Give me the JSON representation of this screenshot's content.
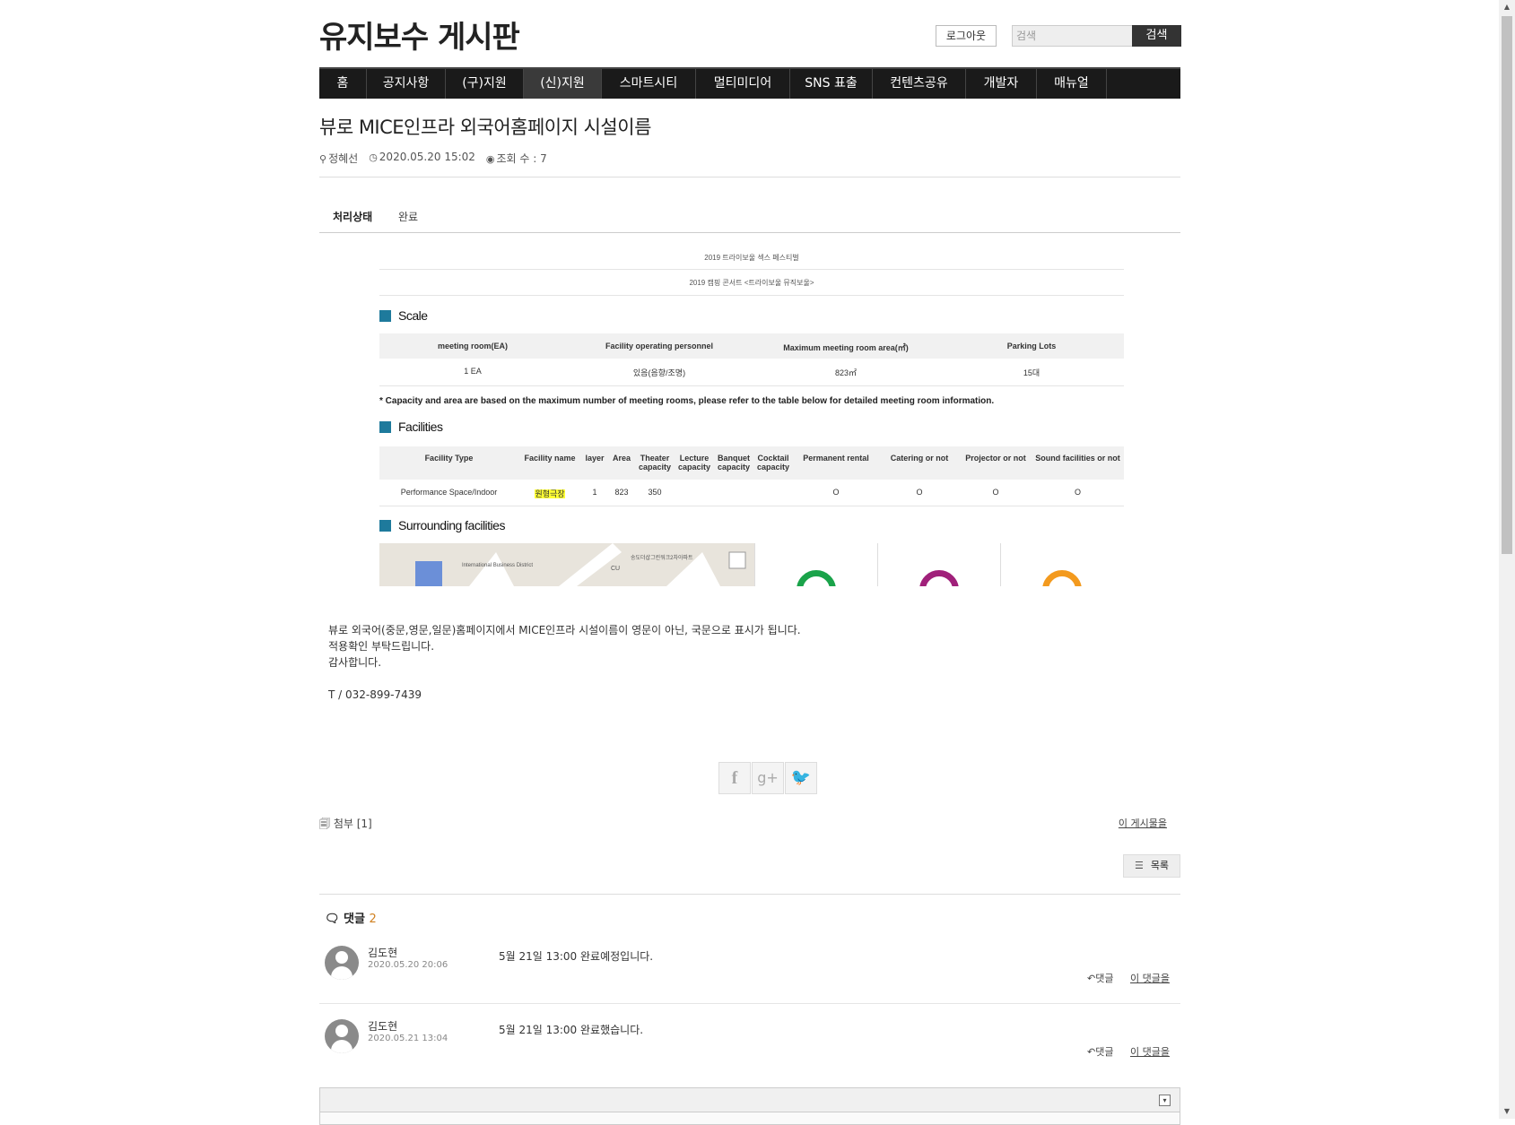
{
  "site": {
    "title": "유지보수 게시판"
  },
  "header": {
    "logout_label": "로그아웃",
    "search_placeholder": "검색",
    "search_button": "검색"
  },
  "nav": {
    "items": [
      "홈",
      "공지사항",
      "(구)지원",
      "(신)지원",
      "스마트시티",
      "멀티미디어",
      "SNS 표출",
      "컨텐츠공유",
      "개발자",
      "매뉴얼"
    ],
    "active": "(신)지원"
  },
  "post": {
    "title": "뷰로 MICE인프라 외국어홈페이지 시설이름",
    "author": "정혜선",
    "datetime": "2020.05.20 15:02",
    "views": "조회 수 : 7",
    "tab_label": "처리상태",
    "tab_value": "완료",
    "body_lines": [
      "뷰로 외국어(중문,영문,일문)홈페이지에서  MICE인프라 시설이름이 영문이 아닌, 국문으로 표시가 됩니다.",
      "적용확인 부탁드립니다.",
      "감사합니다.",
      "",
      "T / 032-899-7439"
    ]
  },
  "screenshot": {
    "caption1": "2019 트라이보울 섹스 페스티벌",
    "caption2": "2019 캠핑 콘서트 <트라이보울 뮤직보울>",
    "scale_title": "Scale",
    "scale_headers": [
      "meeting room(EA)",
      "Facility operating personnel",
      "Maximum meeting room area(㎡)",
      "Parking Lots"
    ],
    "scale_values": [
      "1 EA",
      "있음(음향/조명)",
      "823㎡",
      "15대"
    ],
    "note": "* Capacity and area are based on the maximum number of meeting rooms, please refer to the table below for detailed meeting room information.",
    "facilities_title": "Facilities",
    "facilities_headers": [
      "Facility Type",
      "Facility name",
      "layer",
      "Area",
      "Theater capacity",
      "Lecture capacity",
      "Banquet capacity",
      "Cocktail capacity",
      "Permanent rental",
      "Catering or not",
      "Projector or not",
      "Sound facilities or not"
    ],
    "facilities_row": [
      "Performance Space/Indoor",
      "원형극장",
      "1",
      "823",
      "350",
      "",
      "",
      "",
      "O",
      "O",
      "O",
      "O"
    ],
    "surrounding_title": "Surrounding facilities",
    "map_labels": [
      "International Business District",
      "송도더샵그린워크2차아파트",
      "CU"
    ],
    "ring_colors": [
      "#1aa34a",
      "#a0207a",
      "#f39a1e"
    ]
  },
  "share": {
    "icons": [
      "facebook-icon",
      "google-plus-icon",
      "twitter-icon"
    ]
  },
  "attachments": {
    "label": "첨부 [1]",
    "this_post": "이 게시물을"
  },
  "list_button": "목록",
  "comments": {
    "label": "댓글",
    "count": "2",
    "items": [
      {
        "name": "김도현",
        "date": "2020.05.20 20:06",
        "text": "5월 21일 13:00 완료예정입니다.",
        "reply": "댓글",
        "this_comment": "이 댓글을"
      },
      {
        "name": "김도현",
        "date": "2020.05.21 13:04",
        "text": "5월 21일 13:00 완료했습니다.",
        "reply": "댓글",
        "this_comment": "이 댓글을"
      }
    ]
  }
}
